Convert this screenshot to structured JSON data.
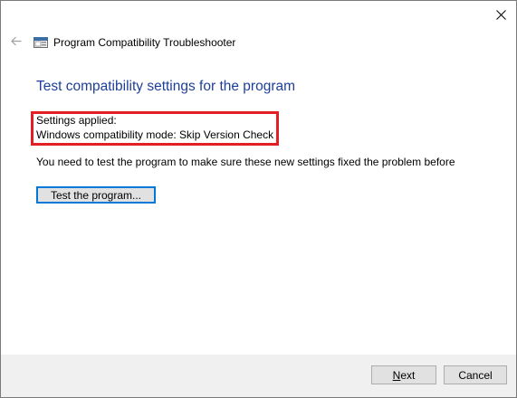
{
  "window": {
    "title": "Program Compatibility Troubleshooter"
  },
  "icons": {
    "close": "close-icon",
    "back": "back-arrow-icon",
    "app": "troubleshooter-icon"
  },
  "main": {
    "heading": "Test compatibility settings for the program",
    "settings_applied_label": "Settings applied:",
    "settings_applied_value": "Windows compatibility mode: Skip Version Check",
    "info_text": "You need to test the program to make sure these new settings fixed the problem before",
    "test_button_label": "Test the program..."
  },
  "footer": {
    "next_accel": "N",
    "next_rest": "ext",
    "cancel_label": "Cancel"
  },
  "colors": {
    "heading": "#1e3f99",
    "highlight_border": "#e31e24",
    "focus_border": "#0078d7"
  }
}
